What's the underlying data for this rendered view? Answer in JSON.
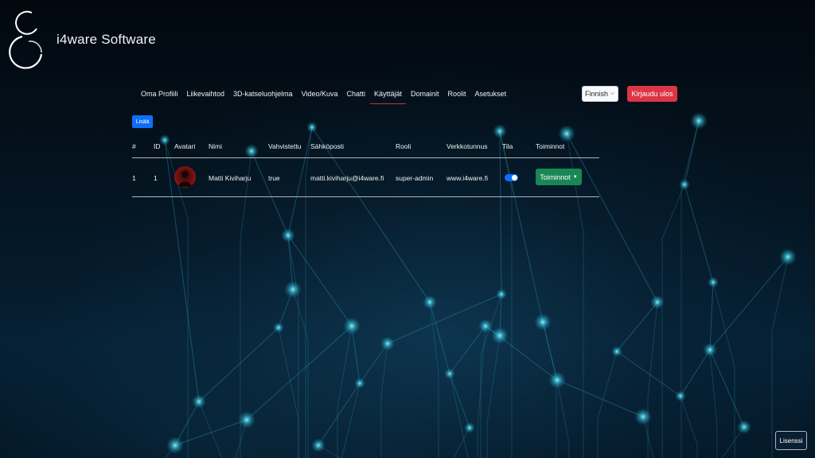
{
  "app": {
    "title": "i4ware Software"
  },
  "nav": {
    "items": [
      {
        "label": "Oma Profiili"
      },
      {
        "label": "Liikevaihtod"
      },
      {
        "label": "3D-katseluohjelma"
      },
      {
        "label": "Video/Kuva"
      },
      {
        "label": "Chatti"
      },
      {
        "label": "Käyttäjät",
        "active": true
      },
      {
        "label": "Domainit"
      },
      {
        "label": "Roolit"
      },
      {
        "label": "Asetukset"
      }
    ]
  },
  "language_select": {
    "value": "Finnish"
  },
  "logout_label": "Kirjaudu ulos",
  "add_label": "Lisää",
  "table": {
    "headers": [
      "#",
      "ID",
      "Avatari",
      "Nimi",
      "Vahvistettu",
      "Sähköposti",
      "Rooli",
      "Verkkotunnus",
      "Tila",
      "Toiminnot"
    ],
    "rows": [
      {
        "num": "1",
        "id": "1",
        "name": "Matti Kiviharju",
        "verified": "true",
        "email": "matti.kiviharju@i4ware.fi",
        "role": "super-admin",
        "domain": "www.i4ware.fi",
        "active": true,
        "actions_label": "Toiminnot"
      }
    ]
  },
  "license_label": "Lisenssi",
  "colors": {
    "danger": "#dc3545",
    "primary": "#0d6efd",
    "success": "#198754",
    "glow": "#3fd4ea"
  }
}
